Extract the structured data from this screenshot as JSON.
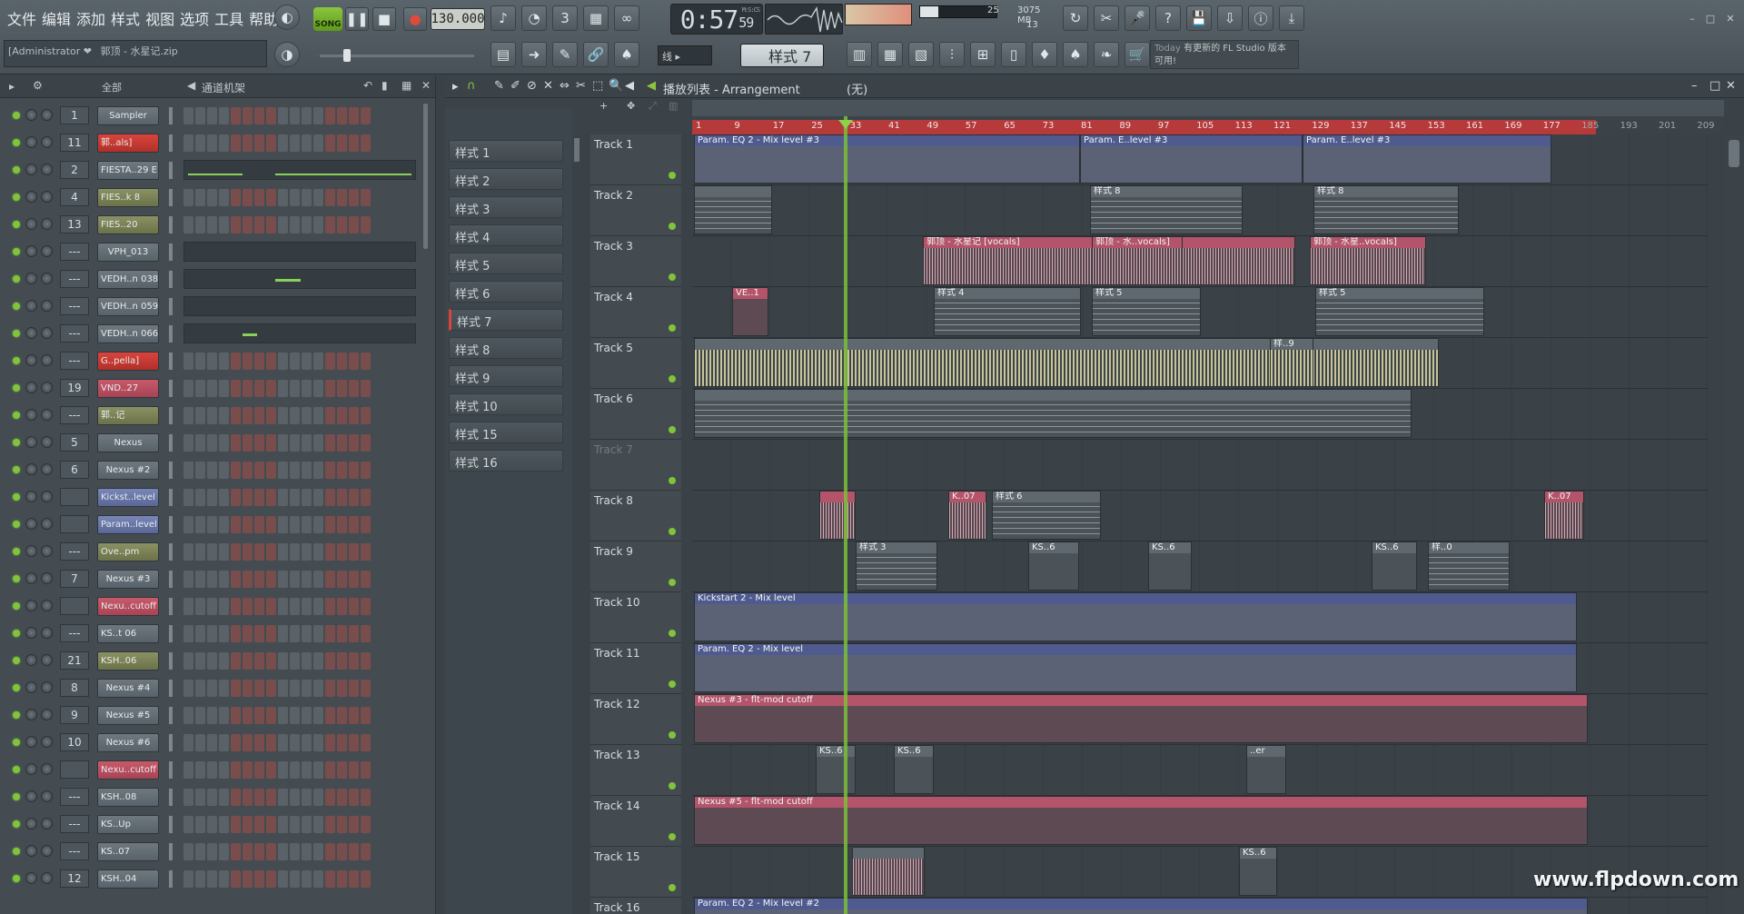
{
  "menu": [
    "文件",
    "编辑",
    "添加",
    "样式",
    "视图",
    "选项",
    "工具",
    "帮助"
  ],
  "transport": {
    "mode": "SONG",
    "tempo": "130.000",
    "time_main": "0:57",
    "time_sub": "59",
    "time_label": "M:S:CS"
  },
  "cpu": {
    "memory": "3075 MB",
    "voices": "13",
    "cpu_value": "25"
  },
  "admin": {
    "user": "[Administrator ❤",
    "file": "郭顶 - 水星记.zip"
  },
  "snap": "线",
  "pattern_selector": "样式 7",
  "news": {
    "today": "Today",
    "text": "有更新的 FL Studio 版本可用!"
  },
  "rack": {
    "filter": "全部",
    "title": "通道机架"
  },
  "channels": [
    {
      "num": "1",
      "name": "Sampler",
      "style": "center",
      "mode": "steps"
    },
    {
      "num": "11",
      "name": "郭..als]",
      "style": "red",
      "mode": "steps"
    },
    {
      "num": "2",
      "name": "FIESTA..29 E",
      "style": "plain",
      "mode": "roll"
    },
    {
      "num": "4",
      "name": "FIES..k 8",
      "style": "olive",
      "mode": "steps"
    },
    {
      "num": "13",
      "name": "FIES..20",
      "style": "olive",
      "mode": "steps"
    },
    {
      "num": "---",
      "name": "VPH_013",
      "style": "center",
      "mode": "roll"
    },
    {
      "num": "---",
      "name": "VEDH..n 038",
      "style": "plain",
      "mode": "roll"
    },
    {
      "num": "---",
      "name": "VEDH..n 059",
      "style": "plain",
      "mode": "roll"
    },
    {
      "num": "---",
      "name": "VEDH..n 066",
      "style": "plain",
      "mode": "roll"
    },
    {
      "num": "---",
      "name": "G..pella]",
      "style": "red",
      "mode": "steps"
    },
    {
      "num": "19",
      "name": "VND..27",
      "style": "pink",
      "mode": "steps"
    },
    {
      "num": "---",
      "name": "郭..记",
      "style": "olive",
      "mode": "steps"
    },
    {
      "num": "5",
      "name": "Nexus",
      "style": "center",
      "mode": "steps"
    },
    {
      "num": "6",
      "name": "Nexus #2",
      "style": "center",
      "mode": "steps"
    },
    {
      "num": "",
      "name": "Kickst..level",
      "style": "blue",
      "mode": "steps"
    },
    {
      "num": "",
      "name": "Param..level",
      "style": "blue",
      "mode": "steps"
    },
    {
      "num": "---",
      "name": "Ove..pm",
      "style": "olive",
      "mode": "steps"
    },
    {
      "num": "7",
      "name": "Nexus #3",
      "style": "center",
      "mode": "steps"
    },
    {
      "num": "",
      "name": "Nexu..cutoff",
      "style": "pink",
      "mode": "steps"
    },
    {
      "num": "---",
      "name": "KS..t 06",
      "style": "plain",
      "mode": "steps"
    },
    {
      "num": "21",
      "name": "KSH..06",
      "style": "olive",
      "mode": "steps"
    },
    {
      "num": "8",
      "name": "Nexus #4",
      "style": "center",
      "mode": "steps"
    },
    {
      "num": "9",
      "name": "Nexus #5",
      "style": "center",
      "mode": "steps"
    },
    {
      "num": "10",
      "name": "Nexus #6",
      "style": "center",
      "mode": "steps"
    },
    {
      "num": "",
      "name": "Nexu..cutoff",
      "style": "pink",
      "mode": "steps"
    },
    {
      "num": "---",
      "name": "KSH..08",
      "style": "plain",
      "mode": "steps"
    },
    {
      "num": "---",
      "name": "KS..Up",
      "style": "plain",
      "mode": "steps"
    },
    {
      "num": "---",
      "name": "KS..07",
      "style": "plain",
      "mode": "steps"
    },
    {
      "num": "12",
      "name": "KSH..04",
      "style": "plain",
      "mode": "steps"
    }
  ],
  "patterns": [
    "样式 1",
    "样式 2",
    "样式 3",
    "样式 4",
    "样式 5",
    "样式 6",
    "样式 7",
    "样式 8",
    "样式 9",
    "样式 10",
    "样式 15",
    "样式 16"
  ],
  "active_pattern": "样式 7",
  "playlist": {
    "title": "播放列表 - Arrangement",
    "subtitle": "(无)"
  },
  "ruler": [
    "1",
    "9",
    "17",
    "25",
    "33",
    "41",
    "49",
    "57",
    "65",
    "73",
    "81",
    "89",
    "97",
    "105",
    "113",
    "121",
    "129",
    "137",
    "145",
    "153",
    "161",
    "169",
    "177",
    "185",
    "193",
    "201",
    "209"
  ],
  "tracks": [
    "Track 1",
    "Track 2",
    "Track 3",
    "Track 4",
    "Track 5",
    "Track 6",
    "Track 7",
    "Track 8",
    "Track 9",
    "Track 10",
    "Track 11",
    "Track 12",
    "Track 13",
    "Track 14",
    "Track 15",
    "Track 16"
  ],
  "clips": {
    "t1a": "Param. EQ 2 - Mix level #3",
    "t1b": "Param. E..level #3",
    "t1c": "Param. E..level #3",
    "t2a": "样式 8",
    "t2b": "样式 8",
    "t3a": "郭顶 - 水星记 [vocals]",
    "t3b": "郭顶 - 水..vocals]",
    "t3c": "郭顶 - 水星..vocals]",
    "t4a": "VE..1",
    "t4b": "样式 4",
    "t4c": "样式 5",
    "t4d": "样式 5",
    "t5a": "样..9",
    "t8a": "K..07",
    "t8b": "样式 6",
    "t8c": "K..07",
    "t9a": "样式 3",
    "t9b": "KS..6",
    "t9c": "KS..6",
    "t9d": "KS..6",
    "t9e": "样..0",
    "t10": "Kickstart 2 - Mix level",
    "t11": "Param. EQ 2 - Mix level",
    "t12": "Nexus #3 - flt-mod cutoff",
    "t13a": "KS..6",
    "t13b": "KS..6",
    "t13c": "..er",
    "t14": "Nexus #5 - flt-mod cutoff",
    "t15": "KS..6",
    "t16": "Param. EQ 2 - Mix level #2"
  },
  "watermark": "www.flpdown.com",
  "colors": {
    "accent": "#8cc63f",
    "ruler": "#b63a3a",
    "automation": "#4f5b8f",
    "pink": "#b3546a"
  }
}
